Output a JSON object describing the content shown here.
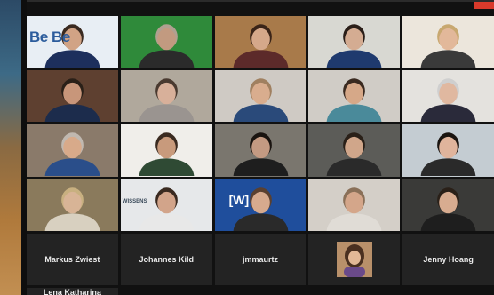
{
  "colors": {
    "accent_red": "#d93a2b",
    "tile_bg": "#232323",
    "dark_bg": "#111111"
  },
  "participants": [
    {
      "id": "t1",
      "name": "",
      "overlay_text": "Be Be",
      "wall": "#e8eef4",
      "skin": "#d1a385",
      "shirt": "#1d2f5c",
      "hair": "#3a2a20"
    },
    {
      "id": "t2",
      "name": "",
      "wall": "#2f8a3a",
      "skin": "#c29a80",
      "shirt": "#2b2b2b",
      "hair": "#b0a090"
    },
    {
      "id": "t3",
      "name": "",
      "wall": "#a87a4a",
      "skin": "#d5a88a",
      "shirt": "#5c2a2a",
      "hair": "#3a2418"
    },
    {
      "id": "t4",
      "name": "",
      "wall": "#d8d8d2",
      "skin": "#d4ac92",
      "shirt": "#1f3a6e",
      "hair": "#2a1e18"
    },
    {
      "id": "t5",
      "name": "",
      "wall": "#ece6dc",
      "skin": "#e2b89a",
      "shirt": "#3a3a3a",
      "hair": "#c8a870"
    },
    {
      "id": "t6",
      "name": "",
      "wall": "#5e4030",
      "skin": "#c8967a",
      "shirt": "#1c2c4c",
      "hair": "#2a2018"
    },
    {
      "id": "t7",
      "name": "",
      "wall": "#b0a89c",
      "skin": "#d8b09a",
      "shirt": "#9a9490",
      "hair": "#4a3a30"
    },
    {
      "id": "t8",
      "name": "",
      "wall": "#cfcac4",
      "skin": "#d9ad8e",
      "shirt": "#2a4a7a",
      "hair": "#a08060"
    },
    {
      "id": "t9",
      "name": "",
      "wall": "#d0ccc6",
      "skin": "#d6a888",
      "shirt": "#4a8a9a",
      "hair": "#3a2a20"
    },
    {
      "id": "t10",
      "name": "",
      "wall": "#e4e2de",
      "skin": "#e0b8a0",
      "shirt": "#2a2a3a",
      "hair": "#cfcfcf"
    },
    {
      "id": "t11",
      "name": "",
      "wall": "#8a7a6a",
      "skin": "#d8aa8a",
      "shirt": "#2a4e8a",
      "hair": "#c0b8b0"
    },
    {
      "id": "t12",
      "name": "",
      "wall": "#f0eeea",
      "skin": "#c89a7c",
      "shirt": "#2f4a34",
      "hair": "#3a2a20"
    },
    {
      "id": "t13",
      "name": "",
      "wall": "#7a766e",
      "skin": "#c49a82",
      "shirt": "#1e1e1e",
      "hair": "#1a1410"
    },
    {
      "id": "t14",
      "name": "",
      "wall": "#5c5c58",
      "skin": "#d0a68a",
      "shirt": "#2a2a2a",
      "hair": "#2a2018"
    },
    {
      "id": "t15",
      "name": "",
      "wall": "#c4ccd2",
      "skin": "#e0b49c",
      "shirt": "#2a2a2a",
      "hair": "#1a1410"
    },
    {
      "id": "t16",
      "name": "",
      "wall": "#8a7a5c",
      "skin": "#d8b496",
      "shirt": "#d8d0c0",
      "hair": "#c8b080"
    },
    {
      "id": "t17",
      "name": "",
      "poster_text": "WISSENS",
      "wall": "#e6e8ea",
      "skin": "#d2a48a",
      "shirt": "#e8e8e8",
      "hair": "#3a2a20"
    },
    {
      "id": "t18",
      "name": "",
      "overlay_text": "[W]",
      "wall": "#1f4e9c",
      "skin": "#d6aa8e",
      "shirt": "#2a2a2a",
      "hair": "#5a4030"
    },
    {
      "id": "t19",
      "name": "",
      "wall": "#d4cfc8",
      "skin": "#d4a68a",
      "shirt": "#e0dcd6",
      "hair": "#8a7058"
    },
    {
      "id": "t20",
      "name": "",
      "wall": "#3a3a38",
      "skin": "#d8ac90",
      "shirt": "#1e1e1e",
      "hair": "#2a2018"
    }
  ],
  "name_tiles": {
    "t21": "Markus Zwiest",
    "t22": "Johannes Kild",
    "t23": "jmmaurtz",
    "t25": "Jenny Hoang",
    "t26": "Lena Katharina"
  },
  "avatar_tile": {
    "id": "t24",
    "name": ""
  }
}
